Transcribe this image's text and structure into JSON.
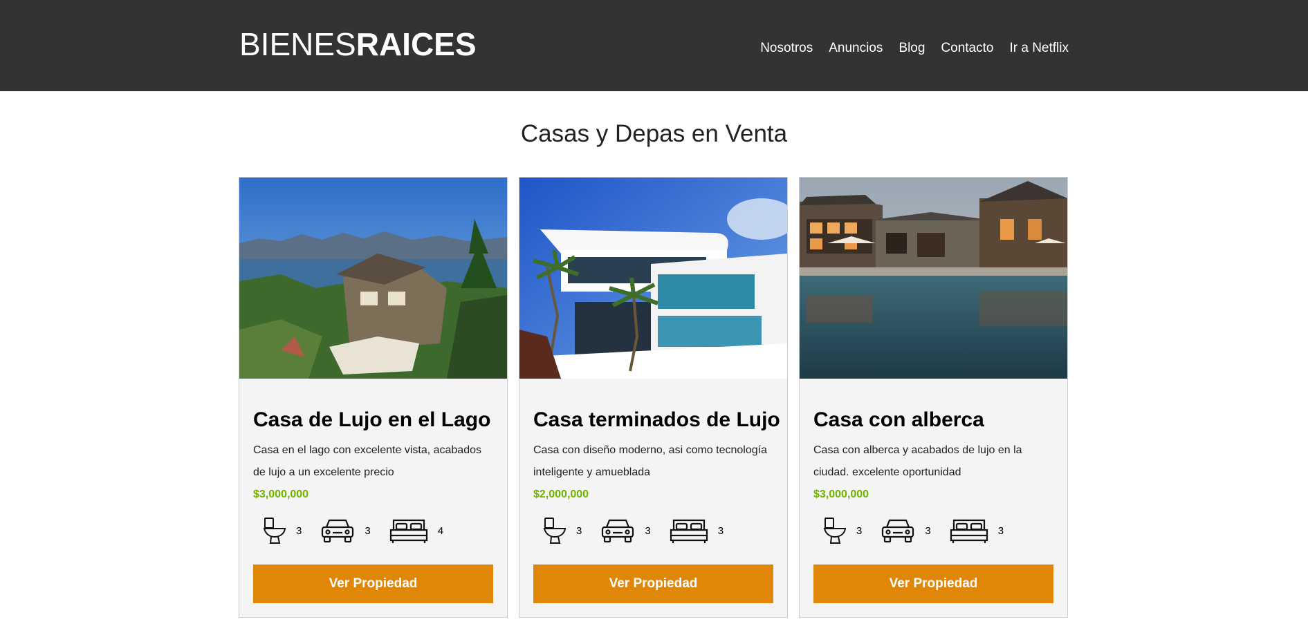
{
  "header": {
    "logo_light": "BIENES",
    "logo_bold": "RAICES",
    "nav": [
      "Nosotros",
      "Anuncios",
      "Blog",
      "Contacto",
      "Ir a Netflix"
    ]
  },
  "section_title": "Casas y Depas en Venta",
  "colors": {
    "header_bg": "#333333",
    "accent": "#e08709",
    "price": "#71b100"
  },
  "icons": [
    "toilet-icon",
    "car-icon",
    "bed-icon"
  ],
  "cards": [
    {
      "image": "lake-house-photo",
      "title": "Casa de Lujo en el Lago",
      "description": "Casa en el lago con excelente vista, acabados de lujo a un excelente precio",
      "price": "$3,000,000",
      "baths": "3",
      "parking": "3",
      "rooms": "4",
      "button": "Ver Propiedad"
    },
    {
      "image": "modern-house-photo",
      "title": "Casa terminados de Lujo",
      "description": "Casa con diseño moderno, asi como tecnología inteligente y amueblada",
      "price": "$2,000,000",
      "baths": "3",
      "parking": "3",
      "rooms": "3",
      "button": "Ver Propiedad"
    },
    {
      "image": "pool-house-photo",
      "title": "Casa con alberca",
      "description": "Casa con alberca y acabados de lujo en la ciudad. excelente oportunidad",
      "price": "$3,000,000",
      "baths": "3",
      "parking": "3",
      "rooms": "3",
      "button": "Ver Propiedad"
    }
  ]
}
